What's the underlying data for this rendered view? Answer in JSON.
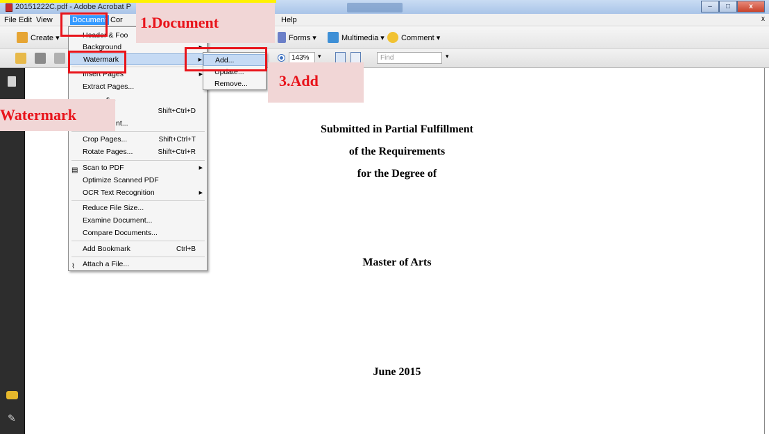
{
  "title_bar": {
    "title": "20151222C.pdf - Adobe Acrobat P",
    "min": "–",
    "max": "□",
    "close": "x"
  },
  "menubar": {
    "items": [
      "File",
      "Edit",
      "View",
      "Document",
      "Cor",
      "Help"
    ],
    "active": "Document",
    "close_glyph": "x"
  },
  "toolbar1": {
    "create": "Create ▾",
    "forms": "Forms ▾",
    "multimedia": "Multimedia ▾",
    "comment": "Comment ▾"
  },
  "toolbar2": {
    "zoom_value": "143%",
    "find_placeholder": "Find"
  },
  "document_menu": {
    "items": [
      {
        "label": "Header & Foo",
        "shortcut": "",
        "has_submenu": true
      },
      {
        "label": "Background",
        "shortcut": "",
        "has_submenu": true
      },
      {
        "label": "Watermark",
        "shortcut": "",
        "has_submenu": true,
        "highlighted": true
      },
      {
        "label": "Insert Pages",
        "shortcut": "",
        "has_submenu": true
      },
      {
        "label": "Extract Pages...",
        "shortcut": ""
      },
      {
        "label": "s...",
        "shortcut": ""
      },
      {
        "label": "...",
        "shortcut": "Shift+Ctrl+D"
      },
      {
        "label": "nt...",
        "shortcut": ""
      },
      {
        "label": "Crop Pages...",
        "shortcut": "Shift+Ctrl+T"
      },
      {
        "label": "Rotate Pages...",
        "shortcut": "Shift+Ctrl+R"
      },
      {
        "label": "Scan to PDF",
        "shortcut": "",
        "has_submenu": true
      },
      {
        "label": "Optimize Scanned PDF",
        "shortcut": ""
      },
      {
        "label": "OCR Text Recognition",
        "shortcut": "",
        "has_submenu": true
      },
      {
        "label": "Reduce File Size...",
        "shortcut": ""
      },
      {
        "label": "Examine Document...",
        "shortcut": ""
      },
      {
        "label": "Compare Documents...",
        "shortcut": ""
      },
      {
        "label": "Add Bookmark",
        "shortcut": "Ctrl+B"
      },
      {
        "label": "Attach a File...",
        "shortcut": ""
      }
    ]
  },
  "watermark_submenu": {
    "items": [
      "Add...",
      "Update...",
      "Remove..."
    ]
  },
  "document": {
    "lines": [
      "Submitted in Partial Fulfillment",
      "of the Requirements",
      "for the Degree of",
      "Master of Arts",
      "June 2015"
    ]
  },
  "annotations": {
    "step1": "1.Document",
    "step2": "Watermark",
    "step3": "3.Add"
  },
  "colors": {
    "annotation_red": "#e8141b",
    "callout_bg": "#f1d6d6",
    "menu_highlight": "#c5daf4",
    "menubar_active": "#3399ff",
    "banner_yellow": "#fff200"
  }
}
